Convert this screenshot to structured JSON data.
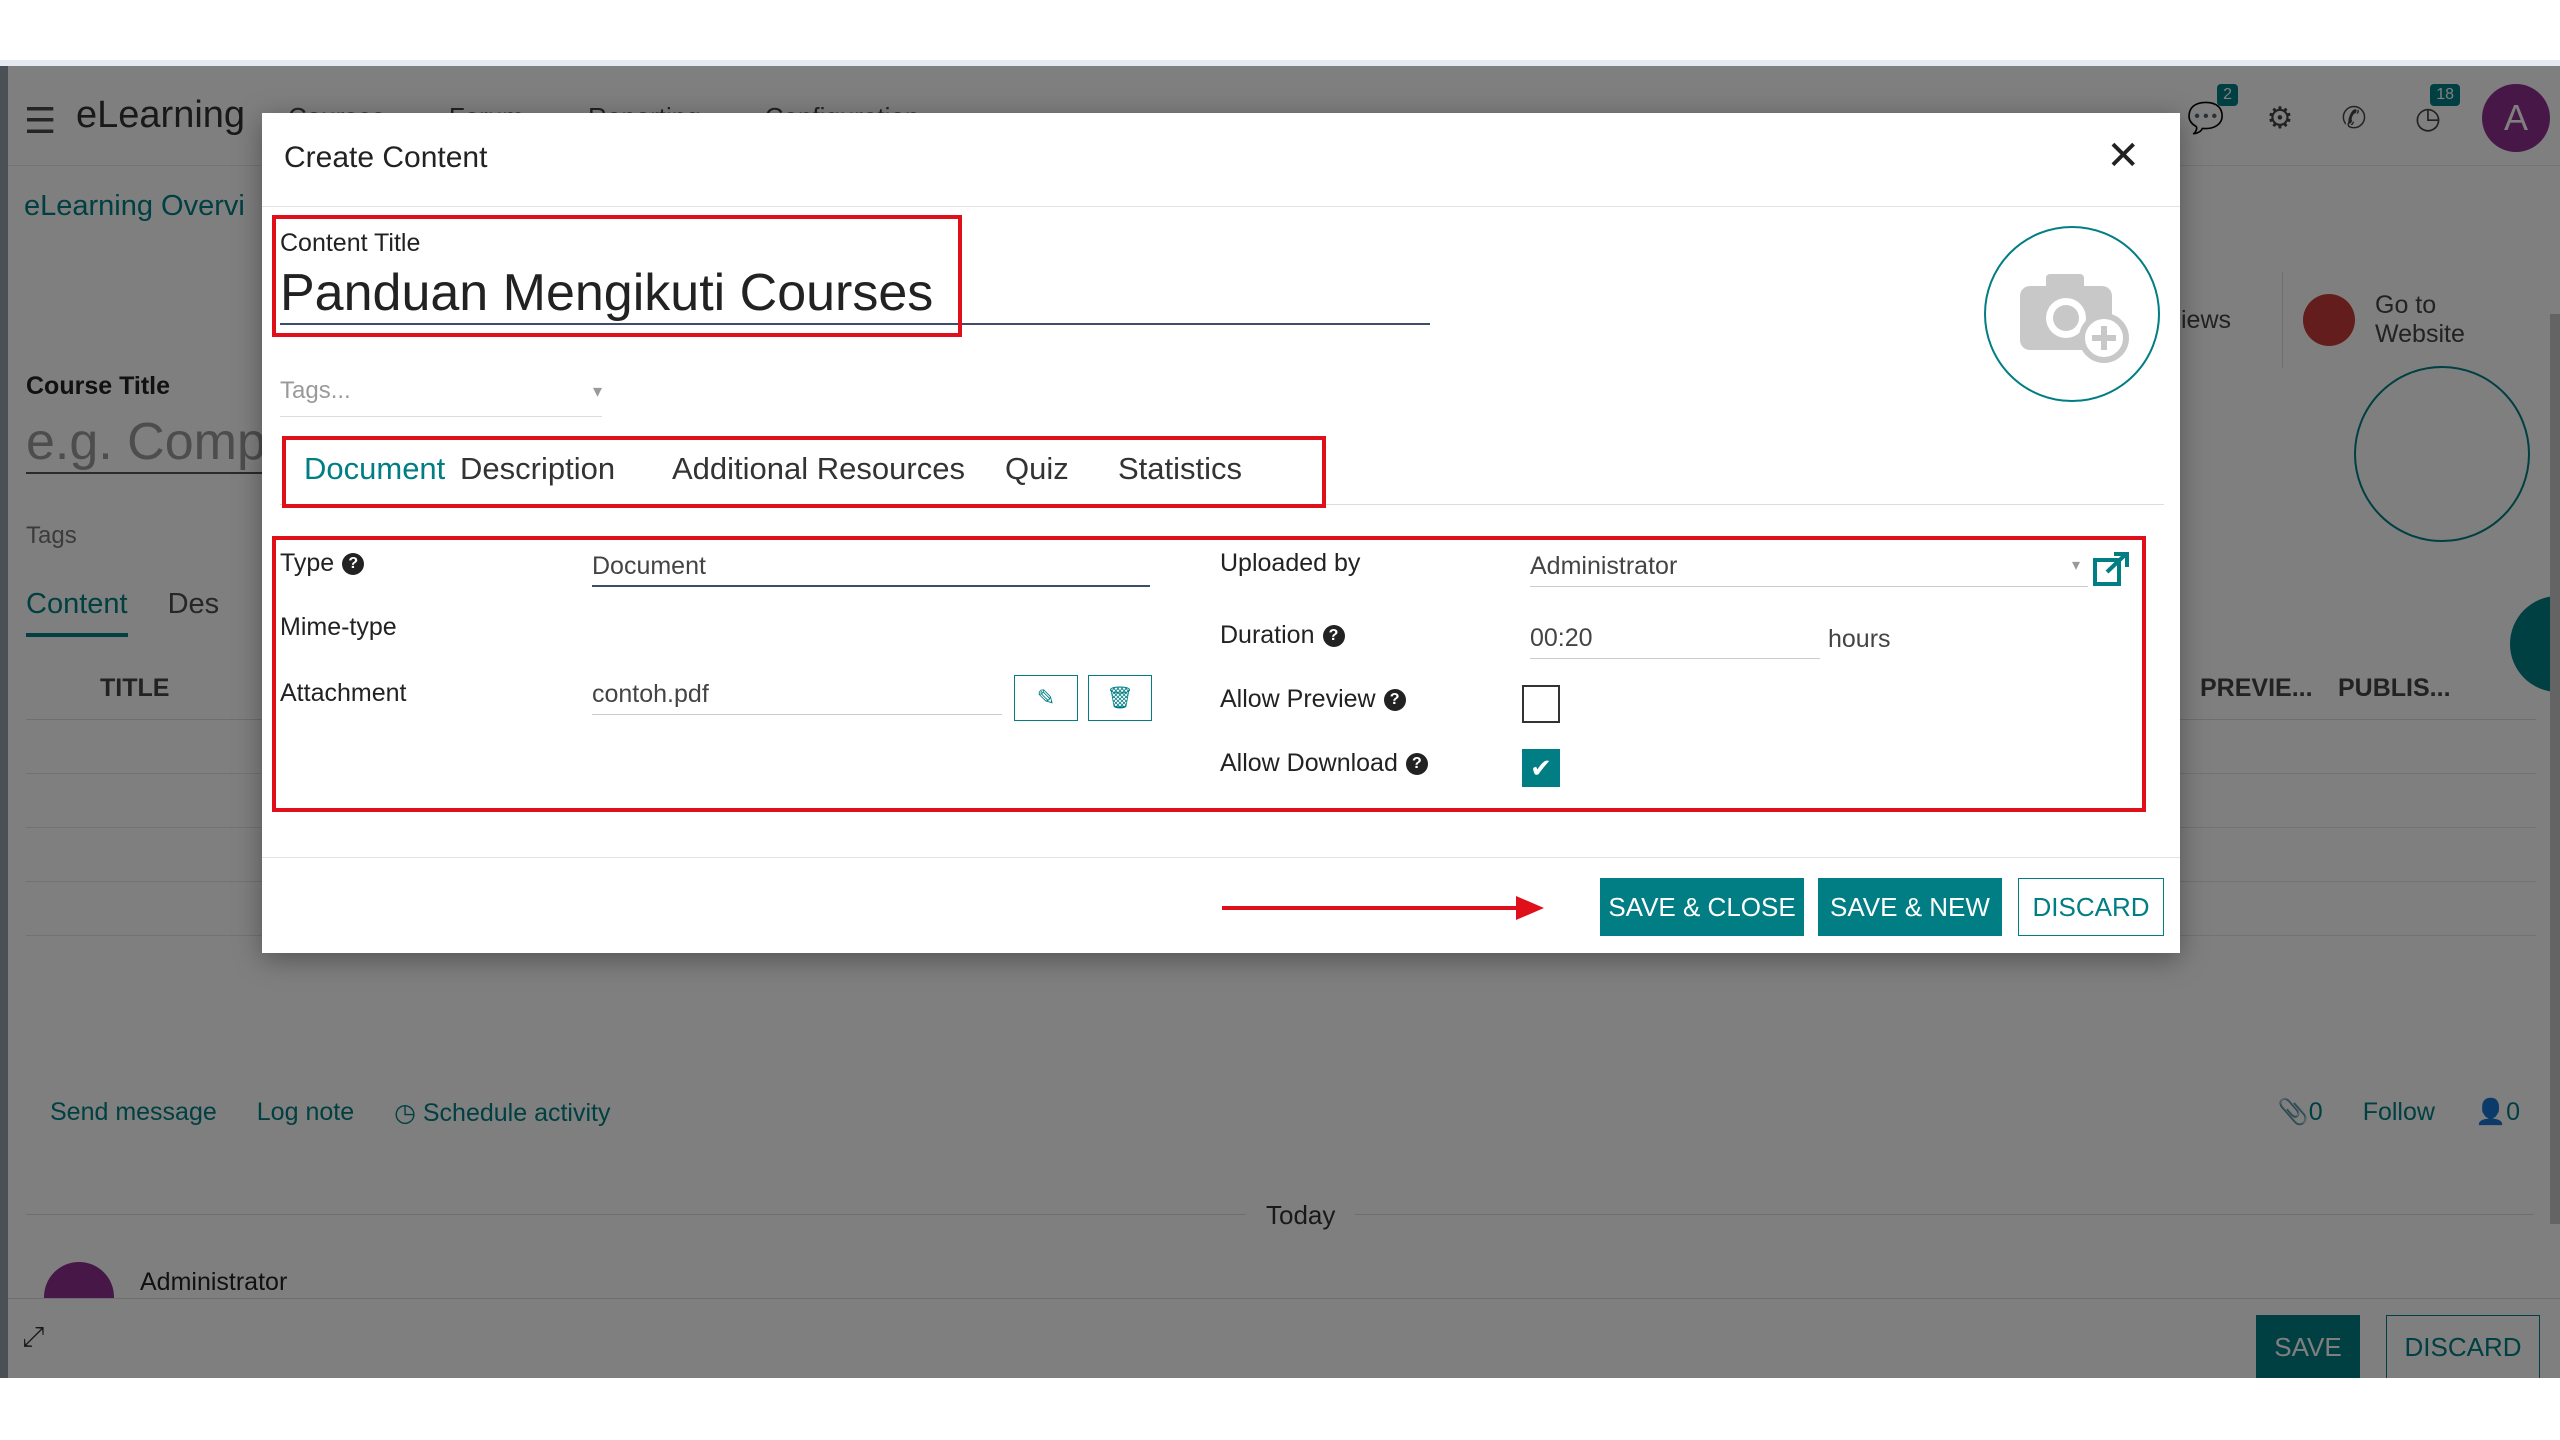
{
  "app": {
    "brand": "eLearning",
    "menu": [
      "Courses",
      "Forum",
      "Reporting",
      "Configuration"
    ],
    "breadcrumb": "eLearning Overvi",
    "smart_buttons": {
      "views": "iews",
      "go_to_website": "Go to\nWebsite"
    },
    "course_title_label": "Course Title",
    "course_title_placeholder": "e.g. Compu",
    "tags_label": "Tags",
    "tabs": [
      "Content",
      "Des"
    ],
    "table_headers": {
      "title": "TITLE",
      "preview": "PREVIE...",
      "published": "PUBLIS..."
    },
    "chatter": {
      "send_message": "Send message",
      "log_note": "Log note",
      "schedule_activity": "Schedule activity",
      "attachments": "0",
      "follow": "Follow",
      "followers": "0"
    },
    "today": "Today",
    "author": "Administrator",
    "footer": {
      "save": "SAVE",
      "discard": "DISCARD"
    },
    "badges": {
      "messages": "2",
      "activities": "18"
    },
    "avatar_initial": "A"
  },
  "modal": {
    "title": "Create Content",
    "content_title_label": "Content Title",
    "content_title_value": "Panduan Mengikuti Courses",
    "tags_placeholder": "Tags...",
    "tabs": [
      {
        "label": "Document",
        "active": true
      },
      {
        "label": "Description",
        "active": false
      },
      {
        "label": "Additional Resources",
        "active": false
      },
      {
        "label": "Quiz",
        "active": false
      },
      {
        "label": "Statistics",
        "active": false
      }
    ],
    "fields": {
      "type_label": "Type",
      "type_value": "Document",
      "mime_label": "Mime-type",
      "attachment_label": "Attachment",
      "attachment_value": "contoh.pdf",
      "uploaded_by_label": "Uploaded by",
      "uploaded_by_value": "Administrator",
      "duration_label": "Duration",
      "duration_value": "00:20",
      "duration_unit": "hours",
      "allow_preview_label": "Allow Preview",
      "allow_preview": false,
      "allow_download_label": "Allow Download",
      "allow_download": true
    },
    "buttons": {
      "save_close": "SAVE & CLOSE",
      "save_new": "SAVE & NEW",
      "discard": "DISCARD"
    }
  },
  "colors": {
    "accent": "#017e84",
    "annotation": "#e0101a",
    "avatar": "#8e2e8f"
  }
}
